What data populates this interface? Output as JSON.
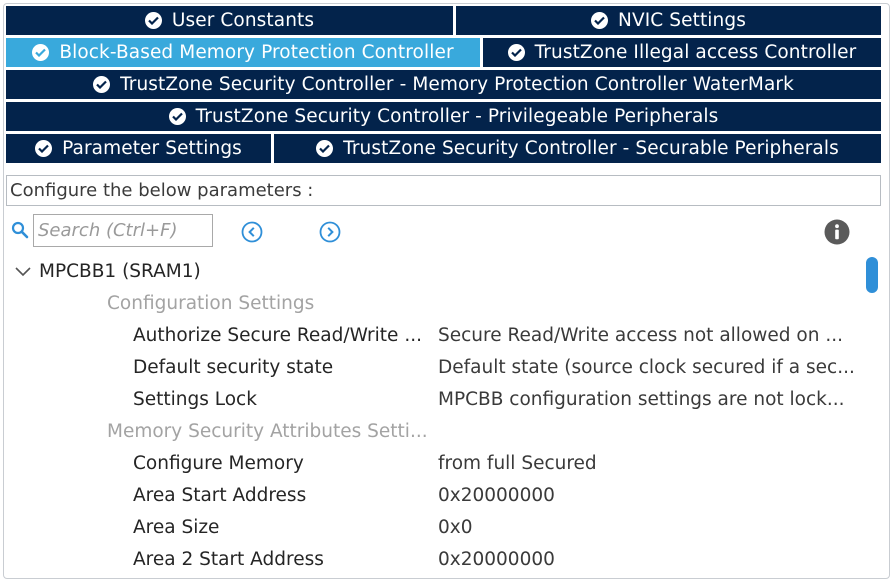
{
  "tabs": {
    "row1": [
      {
        "label": "User Constants"
      },
      {
        "label": "NVIC Settings"
      }
    ],
    "row2": [
      {
        "label": "Block-Based Memory Protection Controller"
      },
      {
        "label": "TrustZone Illegal access Controller"
      }
    ],
    "row3": [
      {
        "label": "TrustZone Security Controller - Memory Protection Controller WaterMark"
      }
    ],
    "row4": [
      {
        "label": "TrustZone Security Controller - Privilegeable Peripherals"
      }
    ],
    "row5": [
      {
        "label": "Parameter Settings"
      },
      {
        "label": "TrustZone Security Controller - Securable Peripherals"
      }
    ]
  },
  "description": "Configure the below parameters :",
  "search": {
    "placeholder": "Search (Ctrl+F)"
  },
  "icons": {
    "search": "search-icon",
    "prev": "circle-chevron-left-icon",
    "next": "circle-chevron-right-icon",
    "info": "info-icon",
    "expand": "chevron-down-icon",
    "tab_ok": "check-circle-icon"
  },
  "colors": {
    "tab_bg": "#03234b",
    "tab_active_bg": "#39a9dc",
    "accent": "#2f8fd8"
  },
  "tree": {
    "root": "MPCBB1 (SRAM1)",
    "groups": [
      {
        "title": "Configuration Settings",
        "params": [
          {
            "label": "Authorize Secure Read/Write ...",
            "value": "Secure Read/Write access not allowed on ..."
          },
          {
            "label": "Default security state",
            "value": "Default state (source clock secured if a sec..."
          },
          {
            "label": "Settings Lock",
            "value": "MPCBB configuration settings are not lock..."
          }
        ]
      },
      {
        "title": "Memory Security Attributes Setti...",
        "params": [
          {
            "label": "Configure Memory",
            "value": "from full Secured"
          },
          {
            "label": "Area Start Address",
            "value": "0x20000000"
          },
          {
            "label": "Area Size",
            "value": "0x0"
          },
          {
            "label": "Area 2 Start Address",
            "value": "0x20000000"
          }
        ]
      }
    ]
  }
}
